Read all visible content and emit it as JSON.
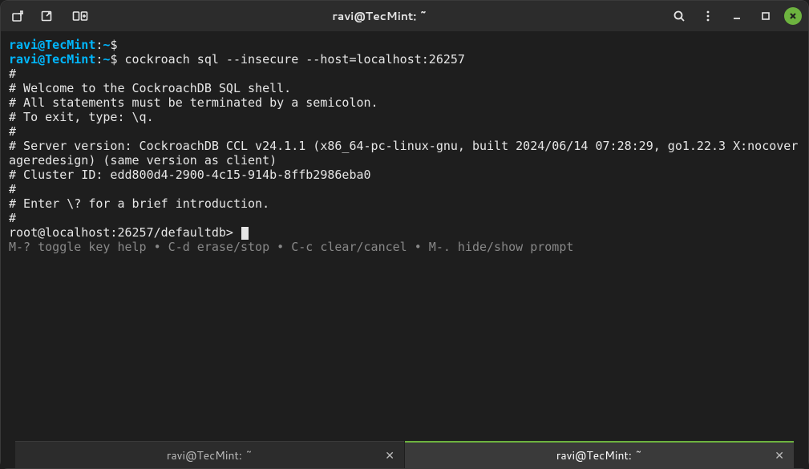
{
  "titlebar": {
    "title": "ravi@TecMint: ~"
  },
  "prompt": {
    "user_host": "ravi@TecMint",
    "sep": ":",
    "path": "~",
    "dollar": "$"
  },
  "commands": {
    "line1": "",
    "line2": "cockroach sql --insecure --host=localhost:26257"
  },
  "output": {
    "l1": "#",
    "l2": "# Welcome to the CockroachDB SQL shell.",
    "l3": "# All statements must be terminated by a semicolon.",
    "l4": "# To exit, type: \\q.",
    "l5": "#",
    "l6": "# Server version: CockroachDB CCL v24.1.1 (x86_64-pc-linux-gnu, built 2024/06/14 07:28:29, go1.22.3 X:nocoverageredesign) (same version as client)",
    "l7": "# Cluster ID: edd800d4-2900-4c15-914b-8ffb2986eba0",
    "l8": "#",
    "l9": "# Enter \\? for a brief introduction.",
    "l10": "#"
  },
  "sql_prompt": "root@localhost:26257/defaultdb> ",
  "help_line": "M-? toggle key help • C-d erase/stop • C-c clear/cancel • M-. hide/show prompt",
  "tabs": {
    "tab1": "ravi@TecMint: ~",
    "tab2": "ravi@TecMint: ~"
  }
}
